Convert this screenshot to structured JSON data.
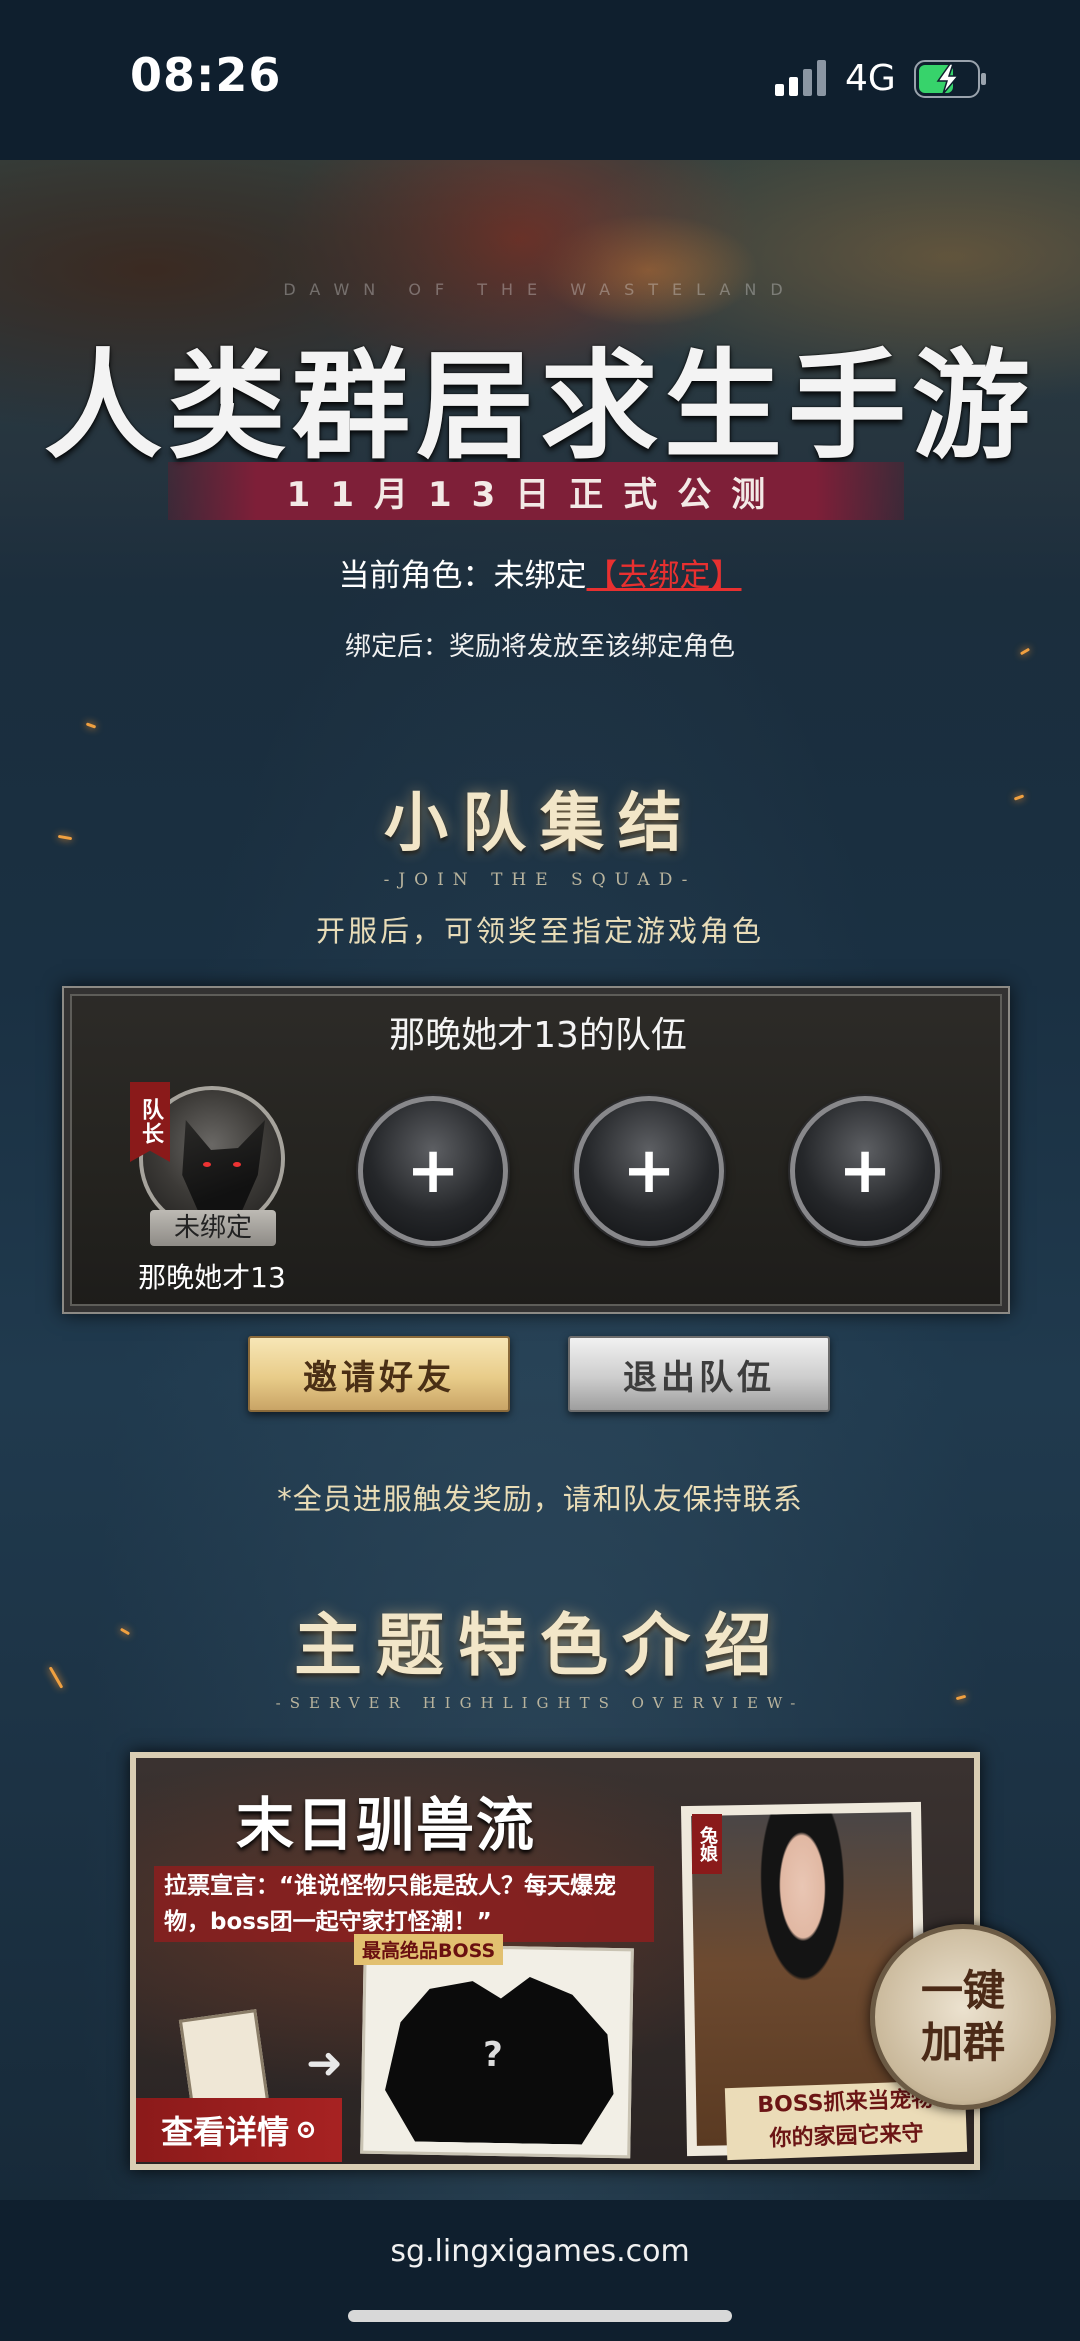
{
  "status_bar": {
    "time": "08:26",
    "network": "4G"
  },
  "hero": {
    "subtext": "DAWN OF THE WASTELAND",
    "title": "人类群居求生手游",
    "launch_date": "11月13日正式公测"
  },
  "account": {
    "role_label": "当前角色：未绑定",
    "bind_link": "【去绑定】",
    "bind_note": "绑定后：奖励将发放至该绑定角色"
  },
  "squad_section": {
    "title": "小队集结",
    "subtitle_en": "-JOIN THE SQUAD-",
    "note": "开服后，可领奖至指定游戏角色"
  },
  "squad": {
    "name": "那晚她才13的队伍",
    "leader": {
      "tag": "队长",
      "status": "未绑定",
      "name": "那晚她才13"
    },
    "add_symbol": "+",
    "invite_label": "邀请好友",
    "leave_label": "退出队伍",
    "reward_note": "*全员进服触发奖励，请和队友保持联系"
  },
  "features_section": {
    "title": "主题特色介绍",
    "subtitle_en": "-SERVER HIGHLIGHTS OVERVIEW-"
  },
  "feature_card": {
    "title": "末日驯兽流",
    "quote": "拉票宣言：“谁说怪物只能是敌人？每天爆宠物，boss团一起守家打怪潮！”",
    "boss_label": "最高绝品BOSS",
    "boss_question": "?",
    "npc_tag": "兔娘",
    "npc_caption_1": "BOSS抓来当宠物",
    "npc_caption_2": "你的家园它来守",
    "details_label": "查看详情",
    "join_group_label": "一键加群"
  },
  "browser": {
    "url": "sg.lingxigames.com"
  },
  "icons": [
    "signal-icon",
    "battery-charging-icon",
    "plus-icon",
    "arrow-right-icon",
    "circle-arrow-icon"
  ]
}
